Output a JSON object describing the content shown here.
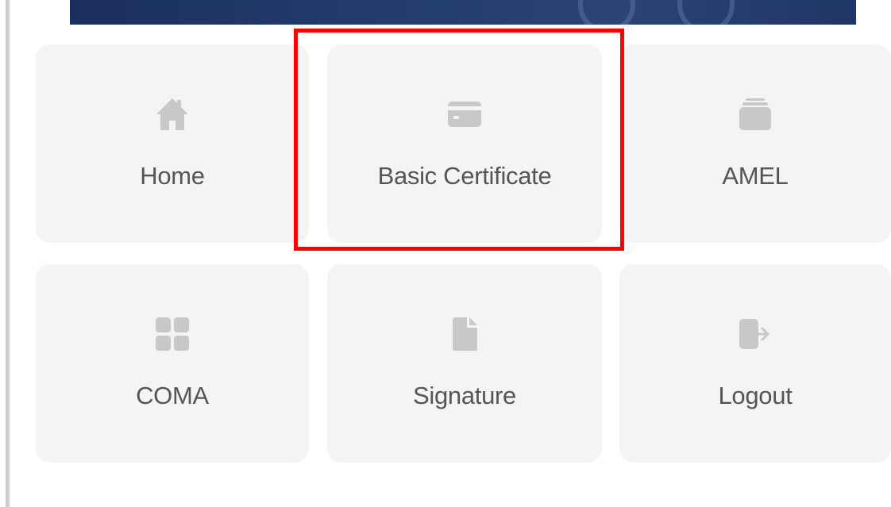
{
  "menu": {
    "tiles": [
      {
        "label": "Home",
        "icon": "home-icon"
      },
      {
        "label": "Basic Certificate",
        "icon": "id-card-icon"
      },
      {
        "label": "AMEL",
        "icon": "stack-icon"
      },
      {
        "label": "COMA",
        "icon": "grid-icon"
      },
      {
        "label": "Signature",
        "icon": "document-icon"
      },
      {
        "label": "Logout",
        "icon": "logout-icon"
      }
    ],
    "highlighted": "Basic Certificate"
  },
  "colors": {
    "tile_background": "#f4f4f4",
    "icon": "#c8c8c8",
    "label": "#555555",
    "highlight_border": "#ff0000",
    "banner": "#1f3565"
  }
}
